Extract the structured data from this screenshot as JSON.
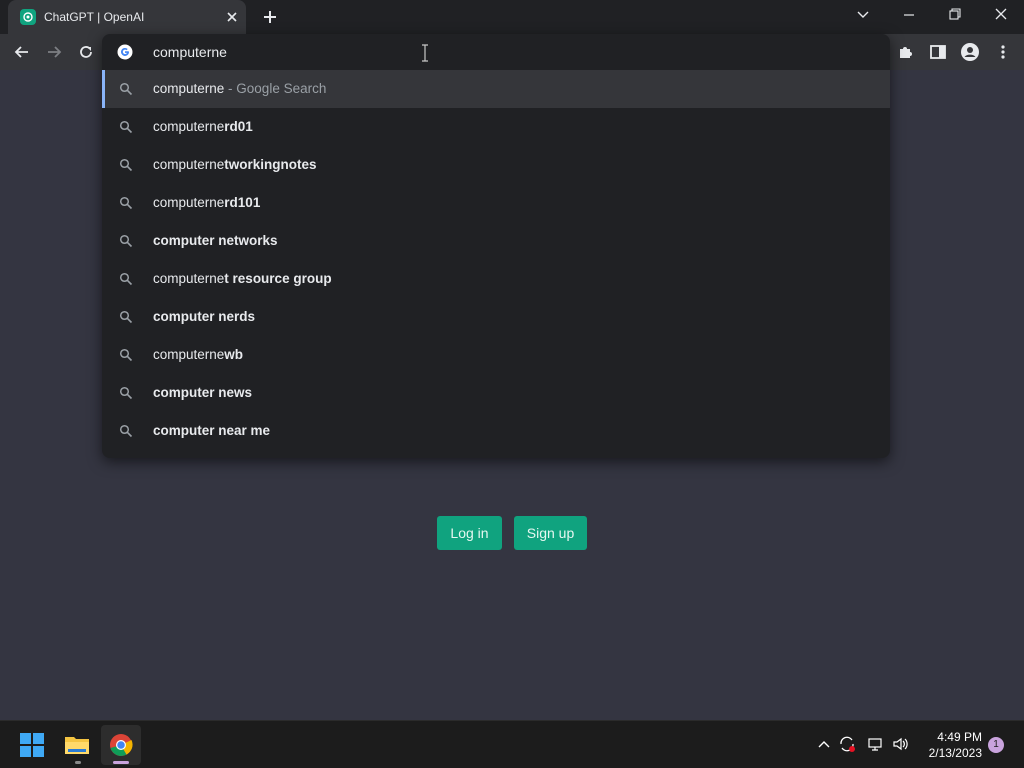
{
  "browser": {
    "tab": {
      "title": "ChatGPT | OpenAI",
      "favicon": "chatgpt-logo-icon",
      "close_icon": "close-icon"
    },
    "new_tab_icon": "plus-icon",
    "window_controls": [
      "chevron-down-icon",
      "minimize-icon",
      "restore-icon",
      "close-icon"
    ],
    "toolbar": {
      "nav_icons": [
        "back-arrow-icon",
        "forward-arrow-icon",
        "reload-icon"
      ],
      "right_icons": [
        "extensions-puzzle-icon",
        "side-panel-icon",
        "profile-icon",
        "more-vertical-icon"
      ]
    }
  },
  "omnibox": {
    "value": "computerne",
    "engine_icon": "google-g-icon",
    "suggestions": [
      {
        "typed": "computerne",
        "completion": "",
        "suffix": " - Google Search",
        "selected": true
      },
      {
        "typed": "computerne",
        "completion": "rd01"
      },
      {
        "typed": "computerne",
        "completion": "tworkingnotes"
      },
      {
        "typed": "computerne",
        "completion": "rd101"
      },
      {
        "typed": "",
        "completion": "computer networks"
      },
      {
        "typed": "computerne",
        "completion": "t resource group"
      },
      {
        "typed": "",
        "completion": "computer nerds"
      },
      {
        "typed": "computerne",
        "completion": "wb"
      },
      {
        "typed": "",
        "completion": "computer news"
      },
      {
        "typed": "",
        "completion": "computer near me"
      }
    ]
  },
  "page": {
    "login_label": "Log in",
    "signup_label": "Sign up",
    "accent_color": "#10a37f",
    "background_color": "#343541"
  },
  "taskbar": {
    "apps": [
      "windows-start-icon",
      "file-explorer-icon",
      "chrome-icon"
    ],
    "tray_icons": [
      "chevron-up-icon",
      "sync-icon",
      "network-icon",
      "volume-icon"
    ],
    "time": "4:49 PM",
    "date": "2/13/2023",
    "notification_count": "1"
  }
}
